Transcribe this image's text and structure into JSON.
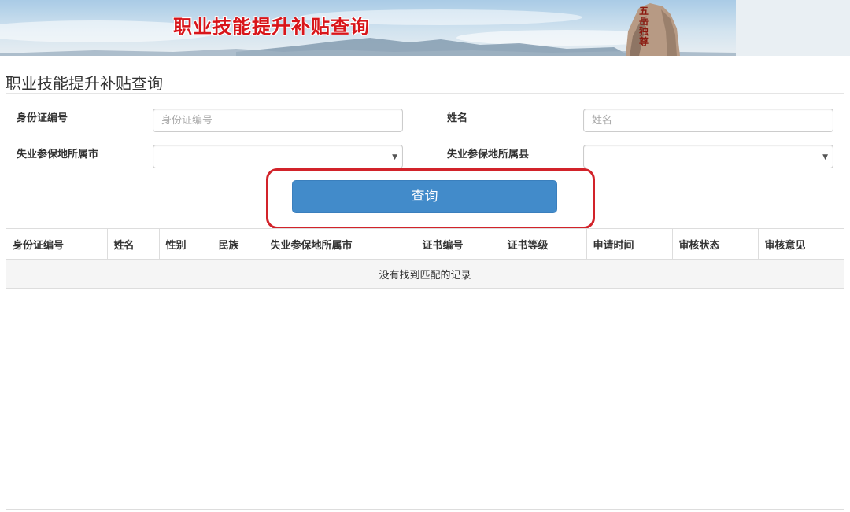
{
  "banner": {
    "title": "职业技能提升补贴查询",
    "rock_text": "五岳独尊"
  },
  "page": {
    "title": "职业技能提升补贴查询"
  },
  "form": {
    "id_label": "身份证编号",
    "id_placeholder": "身份证编号",
    "id_value": "",
    "name_label": "姓名",
    "name_placeholder": "姓名",
    "name_value": "",
    "city_label": "失业参保地所属市",
    "city_value": "",
    "county_label": "失业参保地所属县",
    "county_value": "",
    "query_label": "查询"
  },
  "table": {
    "columns": [
      "身份证编号",
      "姓名",
      "性别",
      "民族",
      "失业参保地所属市",
      "证书编号",
      "证书等级",
      "申请时间",
      "审核状态",
      "审核意见"
    ],
    "empty_text": "没有找到匹配的记录"
  },
  "colors": {
    "primary": "#428bca",
    "banner_title": "#d8151a",
    "highlight": "#d2232a"
  }
}
